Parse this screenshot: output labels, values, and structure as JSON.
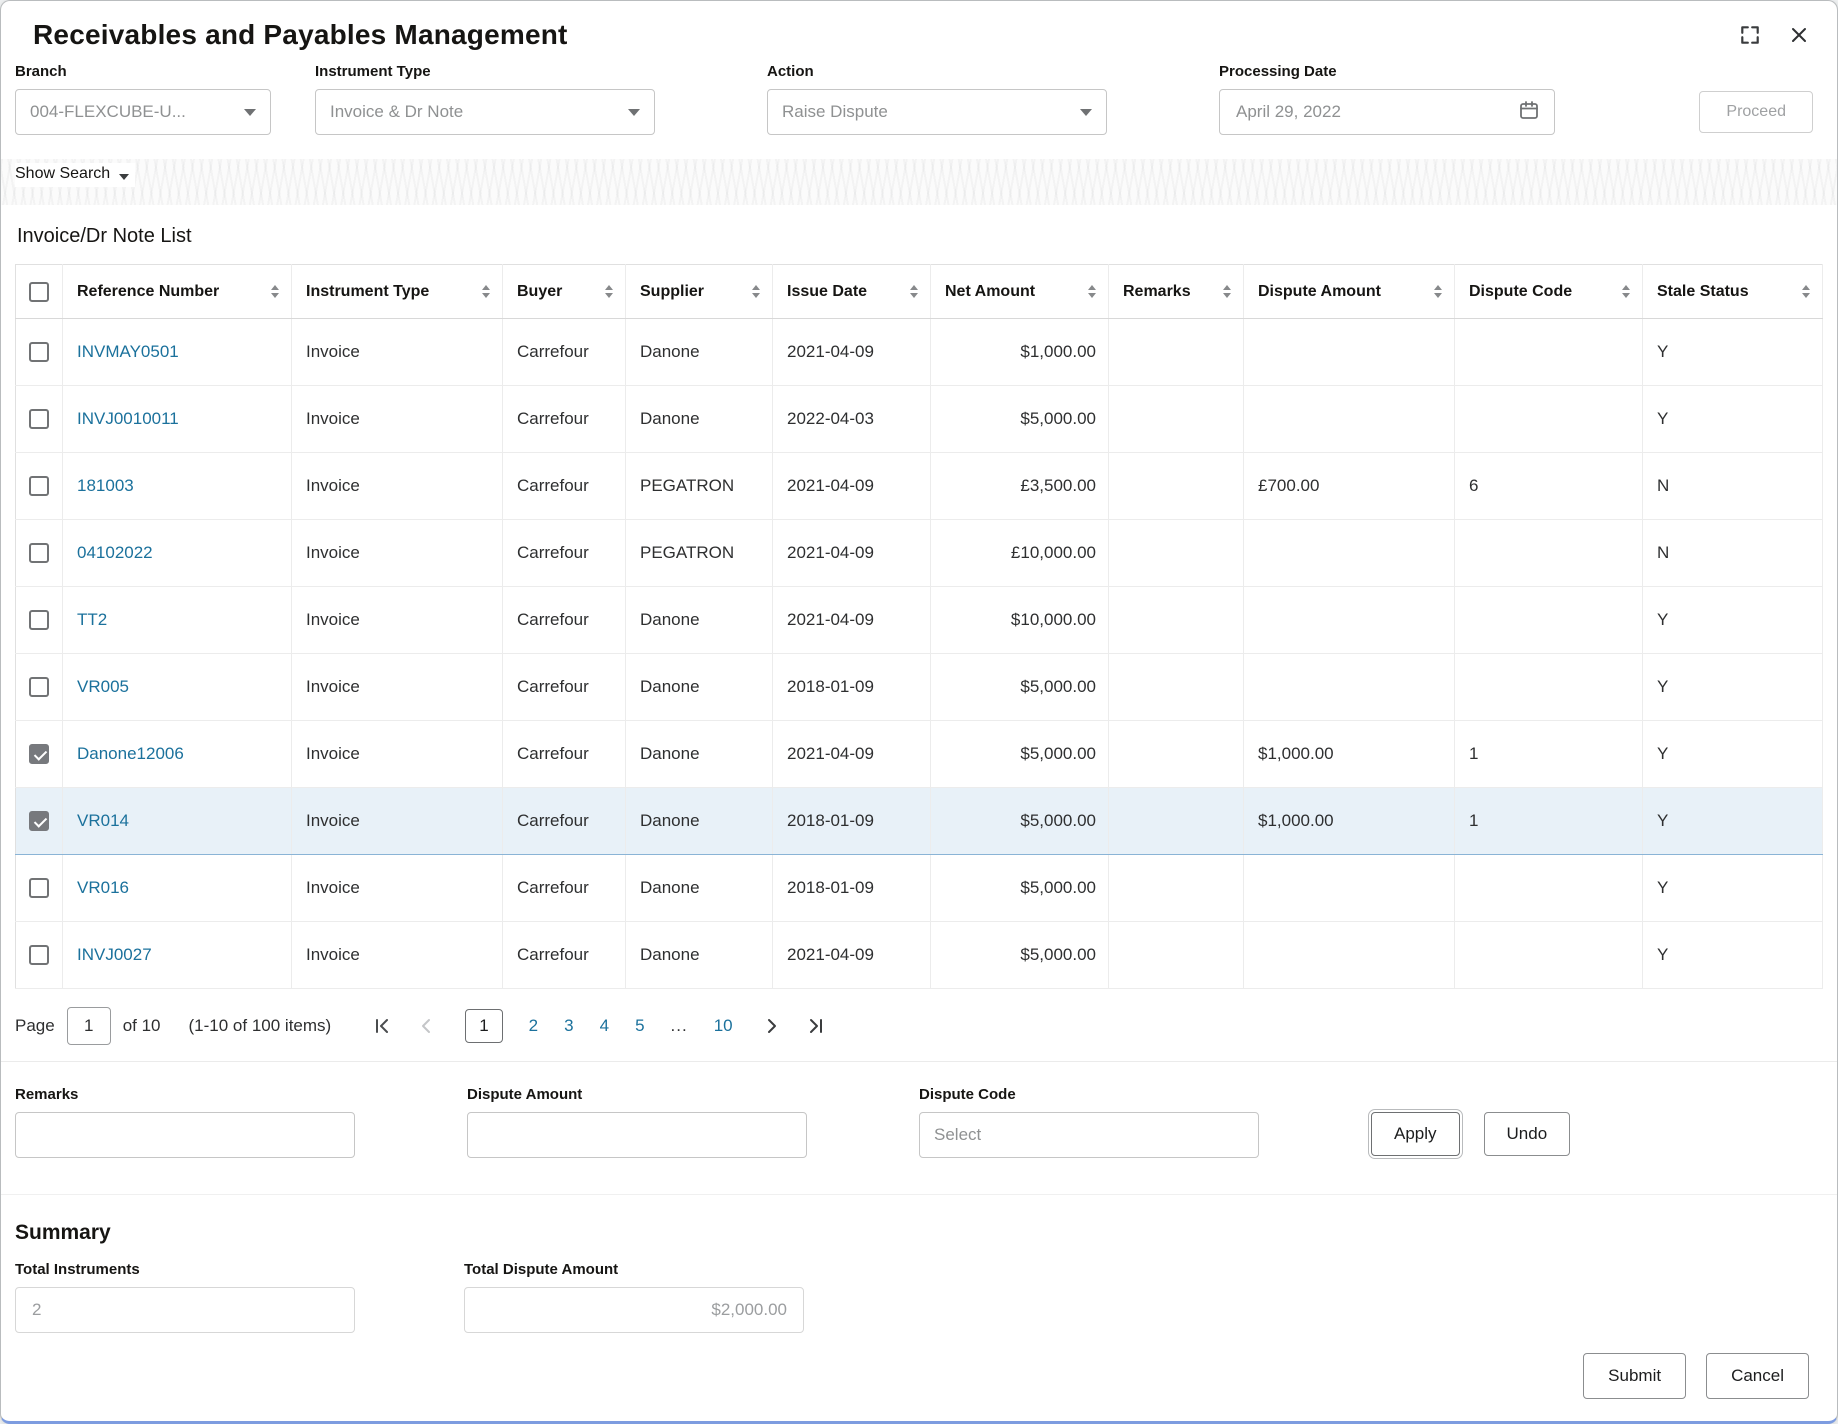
{
  "window": {
    "title": "Receivables and Payables Management"
  },
  "filters": {
    "branch": {
      "label": "Branch",
      "value": "004-FLEXCUBE-U..."
    },
    "instrument_type": {
      "label": "Instrument Type",
      "value": "Invoice & Dr Note"
    },
    "action": {
      "label": "Action",
      "value": "Raise Dispute"
    },
    "processing_date": {
      "label": "Processing Date",
      "value": "April 29, 2022"
    },
    "proceed_label": "Proceed"
  },
  "show_search_label": "Show Search",
  "list": {
    "title": "Invoice/Dr Note List",
    "columns": [
      "Reference Number",
      "Instrument Type",
      "Buyer",
      "Supplier",
      "Issue Date",
      "Net Amount",
      "Remarks",
      "Dispute Amount",
      "Dispute Code",
      "Stale Status"
    ],
    "rows": [
      {
        "ref": "INVMAY0501",
        "instrument": "Invoice",
        "buyer": "Carrefour",
        "supplier": "Danone",
        "issue_date": "2021-04-09",
        "net_amount": "$1,000.00",
        "remarks": "",
        "dispute_amount": "",
        "dispute_code": "",
        "stale_status": "Y",
        "checked": false,
        "selected": false
      },
      {
        "ref": "INVJ0010011",
        "instrument": "Invoice",
        "buyer": "Carrefour",
        "supplier": "Danone",
        "issue_date": "2022-04-03",
        "net_amount": "$5,000.00",
        "remarks": "",
        "dispute_amount": "",
        "dispute_code": "",
        "stale_status": "Y",
        "checked": false,
        "selected": false
      },
      {
        "ref": "181003",
        "instrument": "Invoice",
        "buyer": "Carrefour",
        "supplier": "PEGATRON",
        "issue_date": "2021-04-09",
        "net_amount": "£3,500.00",
        "remarks": "",
        "dispute_amount": "£700.00",
        "dispute_code": "6",
        "stale_status": "N",
        "checked": false,
        "selected": false
      },
      {
        "ref": "04102022",
        "instrument": "Invoice",
        "buyer": "Carrefour",
        "supplier": "PEGATRON",
        "issue_date": "2021-04-09",
        "net_amount": "£10,000.00",
        "remarks": "",
        "dispute_amount": "",
        "dispute_code": "",
        "stale_status": "N",
        "checked": false,
        "selected": false
      },
      {
        "ref": "TT2",
        "instrument": "Invoice",
        "buyer": "Carrefour",
        "supplier": "Danone",
        "issue_date": "2021-04-09",
        "net_amount": "$10,000.00",
        "remarks": "",
        "dispute_amount": "",
        "dispute_code": "",
        "stale_status": "Y",
        "checked": false,
        "selected": false
      },
      {
        "ref": "VR005",
        "instrument": "Invoice",
        "buyer": "Carrefour",
        "supplier": "Danone",
        "issue_date": "2018-01-09",
        "net_amount": "$5,000.00",
        "remarks": "",
        "dispute_amount": "",
        "dispute_code": "",
        "stale_status": "Y",
        "checked": false,
        "selected": false
      },
      {
        "ref": "Danone12006",
        "instrument": "Invoice",
        "buyer": "Carrefour",
        "supplier": "Danone",
        "issue_date": "2021-04-09",
        "net_amount": "$5,000.00",
        "remarks": "",
        "dispute_amount": "$1,000.00",
        "dispute_code": "1",
        "stale_status": "Y",
        "checked": true,
        "selected": false
      },
      {
        "ref": "VR014",
        "instrument": "Invoice",
        "buyer": "Carrefour",
        "supplier": "Danone",
        "issue_date": "2018-01-09",
        "net_amount": "$5,000.00",
        "remarks": "",
        "dispute_amount": "$1,000.00",
        "dispute_code": "1",
        "stale_status": "Y",
        "checked": true,
        "selected": true
      },
      {
        "ref": "VR016",
        "instrument": "Invoice",
        "buyer": "Carrefour",
        "supplier": "Danone",
        "issue_date": "2018-01-09",
        "net_amount": "$5,000.00",
        "remarks": "",
        "dispute_amount": "",
        "dispute_code": "",
        "stale_status": "Y",
        "checked": false,
        "selected": false
      },
      {
        "ref": "INVJ0027",
        "instrument": "Invoice",
        "buyer": "Carrefour",
        "supplier": "Danone",
        "issue_date": "2021-04-09",
        "net_amount": "$5,000.00",
        "remarks": "",
        "dispute_amount": "",
        "dispute_code": "",
        "stale_status": "Y",
        "checked": false,
        "selected": false
      }
    ]
  },
  "pagination": {
    "page_label": "Page",
    "current_page": "1",
    "of_label": "of 10",
    "items_label": "(1-10 of 100 items)",
    "pages": [
      "1",
      "2",
      "3",
      "4",
      "5",
      "...",
      "10"
    ]
  },
  "dispute_form": {
    "remarks_label": "Remarks",
    "remarks_value": "",
    "dispute_amount_label": "Dispute Amount",
    "dispute_amount_value": "",
    "dispute_code_label": "Dispute Code",
    "dispute_code_placeholder": "Select",
    "apply_label": "Apply",
    "undo_label": "Undo"
  },
  "summary": {
    "title": "Summary",
    "total_instruments_label": "Total Instruments",
    "total_instruments_value": "2",
    "total_dispute_label": "Total Dispute Amount",
    "total_dispute_value": "$2,000.00"
  },
  "footer": {
    "submit_label": "Submit",
    "cancel_label": "Cancel"
  },
  "colors": {
    "link": "#1b719c",
    "selected_row_bg": "#e8f1f8",
    "selected_row_border": "#8ab4d6"
  }
}
